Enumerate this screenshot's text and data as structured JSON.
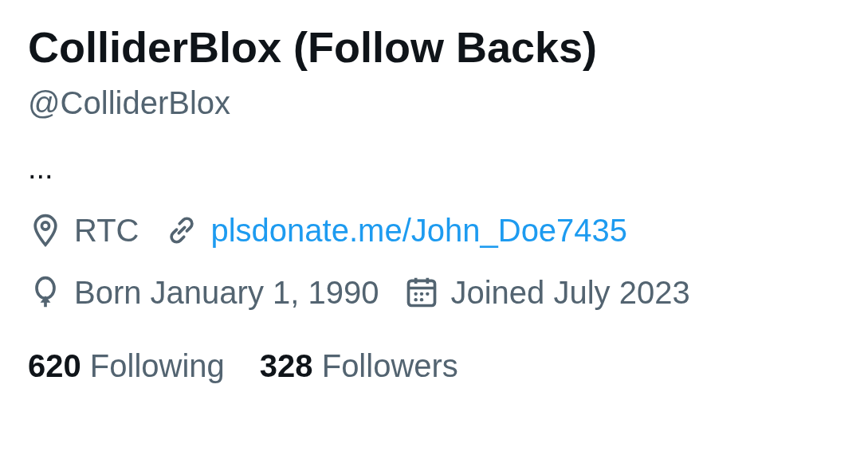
{
  "profile": {
    "display_name": "ColliderBlox (Follow Backs)",
    "handle": "@ColliderBlox",
    "bio": "...",
    "location": "RTC",
    "website": "plsdonate.me/John_Doe7435",
    "birthday": "Born January 1, 1990",
    "joined": "Joined July 2023",
    "stats": [
      {
        "count": "620",
        "label": "Following"
      },
      {
        "count": "328",
        "label": "Followers"
      }
    ]
  }
}
